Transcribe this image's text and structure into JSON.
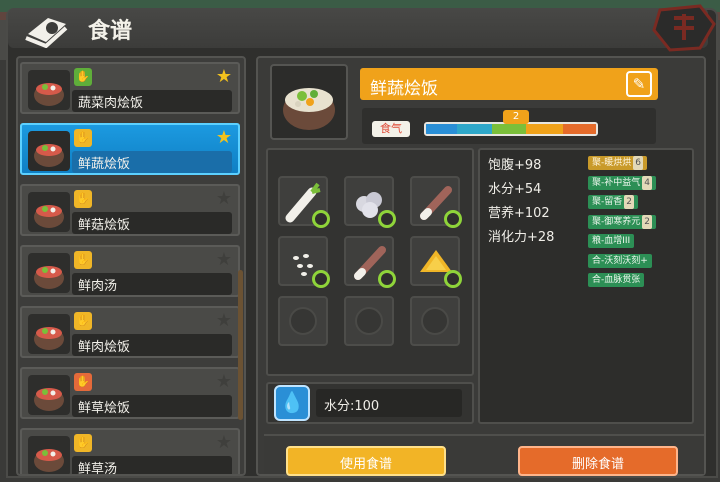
{
  "window": {
    "title": "食谱"
  },
  "recipe_list": [
    {
      "name": "蔬菜肉烩饭",
      "badge_color": "#5fae3a",
      "starred": true,
      "selected": false
    },
    {
      "name": "鲜蔬烩饭",
      "badge_color": "#f0b627",
      "starred": true,
      "selected": true
    },
    {
      "name": "鲜菇烩饭",
      "badge_color": "#f0b627",
      "starred": false,
      "selected": false
    },
    {
      "name": "鲜肉汤",
      "badge_color": "#f0b627",
      "starred": false,
      "selected": false
    },
    {
      "name": "鲜肉烩饭",
      "badge_color": "#f0b627",
      "starred": false,
      "selected": false
    },
    {
      "name": "鲜草烩饭",
      "badge_color": "#e56a3a",
      "starred": false,
      "selected": false
    },
    {
      "name": "鲜草汤",
      "badge_color": "#f0b627",
      "starred": false,
      "selected": false
    }
  ],
  "detail": {
    "dish_name": "鲜蔬烩饭",
    "flavor_label": "食气",
    "flavor_level": "2",
    "flavor_segments": [
      "#2a8fd6",
      "#2fa8c9",
      "#7bbf3a",
      "#f0a21a",
      "#e56b2a"
    ],
    "ingredients": [
      {
        "name": "radish-icon"
      },
      {
        "name": "rice-icon"
      },
      {
        "name": "meat-stick-icon"
      },
      {
        "name": "seeds-icon"
      },
      {
        "name": "meat-stick-icon"
      },
      {
        "name": "mushroom-icon"
      }
    ],
    "stats": [
      {
        "label": "饱腹+98"
      },
      {
        "label": "水分+54"
      },
      {
        "label": "营养+102"
      },
      {
        "label": "消化力+28"
      }
    ],
    "effects": [
      {
        "text": "聚-暖烘烘",
        "count": "6",
        "style": "gold"
      },
      {
        "text": "聚-补中益气",
        "count": "4",
        "style": "green"
      },
      {
        "text": "聚-留香",
        "count": "2",
        "style": "green"
      },
      {
        "text": "聚-御寒养元",
        "count": "2",
        "style": "green"
      },
      {
        "text": "粮-血增III",
        "count": "",
        "style": "green"
      },
      {
        "text": "合-沃刻沃刻+",
        "count": "",
        "style": "green"
      },
      {
        "text": "合-血脉贯张",
        "count": "",
        "style": "green"
      }
    ],
    "water_text": "水分:100"
  },
  "buttons": {
    "use": "使用食谱",
    "delete": "删除食谱"
  }
}
